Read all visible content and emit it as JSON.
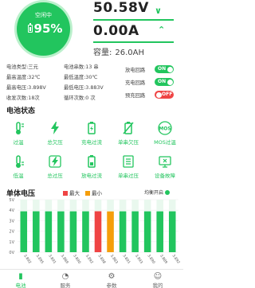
{
  "battery": {
    "status": "空闲中",
    "percent": "95%"
  },
  "voltage": {
    "value": "50.58V"
  },
  "current": {
    "value": "0.00A"
  },
  "capacity": {
    "label": "容量:",
    "value": "26.0AH"
  },
  "info": {
    "type": "电池类型:三元",
    "series": "电池串数:13 串",
    "max_temp": "最高温度:32℃",
    "min_temp": "最低温度:30℃",
    "max_cell": "最高电压:3.898V",
    "min_cell": "最低电压:3.883V",
    "recv_status": "收发次数:18次",
    "cycles": "循环次数:0 次"
  },
  "switches": {
    "discharge": {
      "label": "放电回路",
      "state": "ON"
    },
    "charge": {
      "label": "充电回路",
      "state": "ON"
    },
    "precharge": {
      "label": "预充回路",
      "state": "OFF"
    }
  },
  "status_section": {
    "title": "电池状态"
  },
  "status_items": [
    {
      "label": "过温",
      "icon": "thermometer-icon"
    },
    {
      "label": "总欠压",
      "icon": "lightning-icon"
    },
    {
      "label": "充电过流",
      "icon": "battery-charge-icon"
    },
    {
      "label": "单串欠压",
      "icon": "battery-slash-icon"
    },
    {
      "label": "MOS过温",
      "icon": "mos-icon"
    },
    {
      "label": "低温",
      "icon": "thermometer-low-icon"
    },
    {
      "label": "总过压",
      "icon": "lightning-box-icon"
    },
    {
      "label": "放电过流",
      "icon": "battery-discharge-icon"
    },
    {
      "label": "单串过压",
      "icon": "list-icon"
    },
    {
      "label": "设备故障",
      "icon": "device-fault-icon"
    }
  ],
  "cells": {
    "title": "单体电压",
    "legend_max": "最大",
    "legend_min": "最小",
    "balance": "均衡开启",
    "colors": {
      "max": "#ef4444",
      "min": "#f59e0b",
      "normal": "#22c55e"
    }
  },
  "chart_data": {
    "type": "bar",
    "categories": [
      "1",
      "2",
      "3",
      "4",
      "5",
      "6",
      "7",
      "8",
      "9",
      "10",
      "11",
      "12",
      "13"
    ],
    "values": [
      3.892,
      3.895,
      3.891,
      3.889,
      3.89,
      3.892,
      3.898,
      3.883,
      3.891,
      3.893,
      3.89,
      3.889,
      3.892
    ],
    "labels": [
      "3.892",
      "3.895",
      "3.891",
      "3.889",
      "3.890",
      "3.892",
      "3.898",
      "3.883",
      "3.891",
      "3.893",
      "3.890",
      "3.889",
      "3.892"
    ],
    "yticks": [
      "0V",
      "1V",
      "2V",
      "3V",
      "4V",
      "5V"
    ],
    "ylim": [
      0,
      5
    ],
    "max_index": 6,
    "min_index": 7
  },
  "nav": [
    {
      "label": "电池",
      "icon": "battery-nav-icon",
      "active": true
    },
    {
      "label": "服务",
      "icon": "service-icon",
      "active": false
    },
    {
      "label": "参数",
      "icon": "params-icon",
      "active": false
    },
    {
      "label": "我的",
      "icon": "profile-icon",
      "active": false
    }
  ]
}
